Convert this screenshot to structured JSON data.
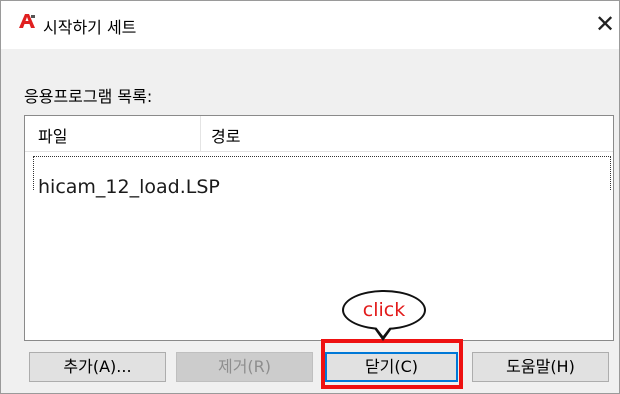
{
  "window": {
    "title": "시작하기 세트",
    "close_symbol": "✕"
  },
  "list": {
    "label": "응용프로그램 목록:",
    "columns": [
      "파일",
      "경로"
    ],
    "rows": [
      {
        "file": "hicam_12_load.LSP",
        "path": ""
      }
    ]
  },
  "buttons": {
    "add": "추가(A)...",
    "remove": "제거(R)",
    "close": "닫기(C)",
    "help": "도움말(H)"
  },
  "annotation": {
    "callout": "click"
  },
  "icons": {
    "app": "autocad-a-icon",
    "close": "close-icon"
  },
  "colors": {
    "highlight": "#ee1111",
    "callout_text": "#e21a1a",
    "focus_border": "#0078d7",
    "app_icon": "#e02020"
  }
}
